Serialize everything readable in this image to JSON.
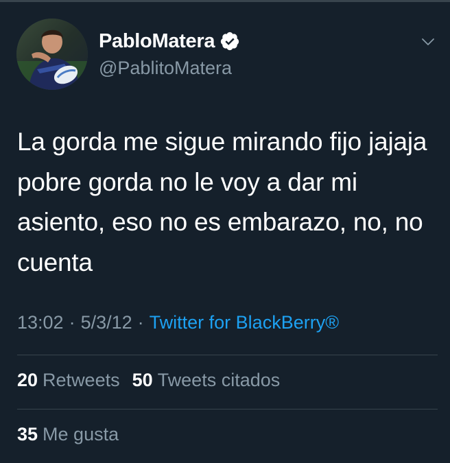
{
  "colors": {
    "background": "#15202b",
    "text_primary": "#ffffff",
    "text_secondary": "#8899a6",
    "link": "#1da1f2",
    "divider": "#38444d"
  },
  "author": {
    "display_name": "PabloMatera",
    "handle": "@PablitoMatera",
    "verified": true,
    "verified_icon": "verified-badge-icon",
    "avatar_icon": "profile-avatar"
  },
  "menu_icon": "chevron-down-icon",
  "tweet": {
    "text": "La gorda me sigue mirando fijo jajaja pobre gorda no le voy a dar mi asiento, eso no es embarazo, no, no cuenta",
    "time": "13:02",
    "separator": "·",
    "date": "5/3/12",
    "source": "Twitter for BlackBerry®"
  },
  "stats": {
    "retweets_count": "20",
    "retweets_label": "Retweets",
    "quotes_count": "50",
    "quotes_label": "Tweets citados",
    "likes_count": "35",
    "likes_label": "Me gusta"
  }
}
